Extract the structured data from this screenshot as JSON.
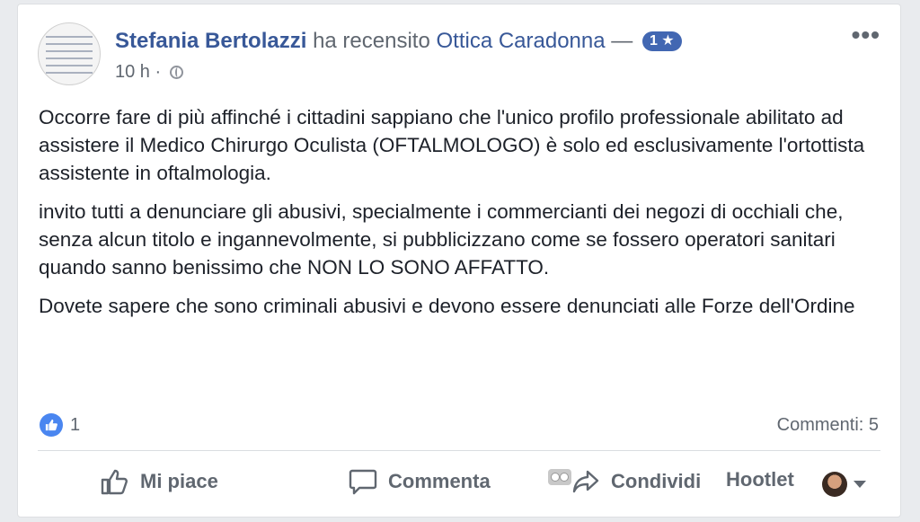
{
  "post": {
    "author": "Stefania Bertolazzi",
    "verb": "ha recensito",
    "page": "Ottica Caradonna",
    "dash": "—",
    "rating": "1 ★",
    "time": "10 h",
    "dot": "·",
    "paragraphs": [
      "Occorre fare di più affinché i cittadini sappiano che l'unico profilo professionale abilitato ad assistere il Medico Chirurgo Oculista (OFTALMOLOGO) è solo ed esclusivamente l'ortottista assistente in oftalmologia.",
      "invito tutti a denunciare gli abusivi, specialmente i commercianti dei negozi di occhiali che, senza alcun titolo e ingannevolmente, si pubblicizzano come se fossero operatori sanitari quando sanno benissimo che NON LO SONO AFFATTO.",
      "Dovete sapere che sono criminali abusivi e devono essere denunciati alle Forze dell'Ordine"
    ]
  },
  "stats": {
    "likes": "1",
    "comments": "Commenti: 5"
  },
  "actions": {
    "like": "Mi piace",
    "comment": "Commenta",
    "share": "Condividi",
    "hootlet": "Hootlet"
  },
  "icons": {
    "more": "more-icon",
    "like": "thumb-up-icon",
    "comment": "comment-icon",
    "share": "share-icon"
  },
  "colors": {
    "link": "#385898",
    "badge": "#4267b2",
    "like": "#4a86f0",
    "text": "#1d2129",
    "muted": "#606770"
  }
}
